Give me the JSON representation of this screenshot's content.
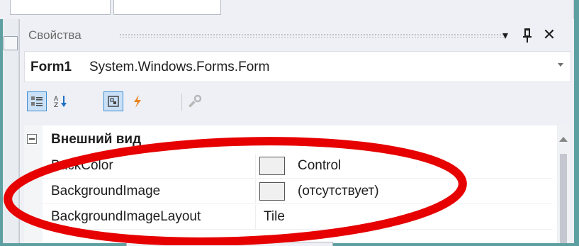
{
  "panel": {
    "title": "Свойства",
    "buttons": {
      "dropdown": "▾",
      "pin": "ᵽ",
      "close": "✕"
    }
  },
  "object_selector": {
    "name": "Form1",
    "type": "System.Windows.Forms.Form"
  },
  "toolbar": {
    "tools": [
      {
        "name": "categorized-icon",
        "active": true
      },
      {
        "name": "alphabetical-icon",
        "active": false
      },
      {
        "name": "properties-icon",
        "active": true
      },
      {
        "name": "events-icon",
        "active": false
      },
      {
        "name": "property-pages-icon",
        "active": false
      }
    ]
  },
  "grid": {
    "category": "Внешний вид",
    "rows": [
      {
        "name": "BackColor",
        "value": "Control",
        "has_swatch": true
      },
      {
        "name": "BackgroundImage",
        "value": "(отсутствует)",
        "has_swatch": true
      },
      {
        "name": "BackgroundImageLayout",
        "value": "Tile",
        "has_swatch": false
      }
    ]
  },
  "colors": {
    "frame": "#5ea0a1",
    "highlight": "#e60000",
    "active_tool": "#3e8ed0",
    "events_icon": "#e8831f"
  }
}
